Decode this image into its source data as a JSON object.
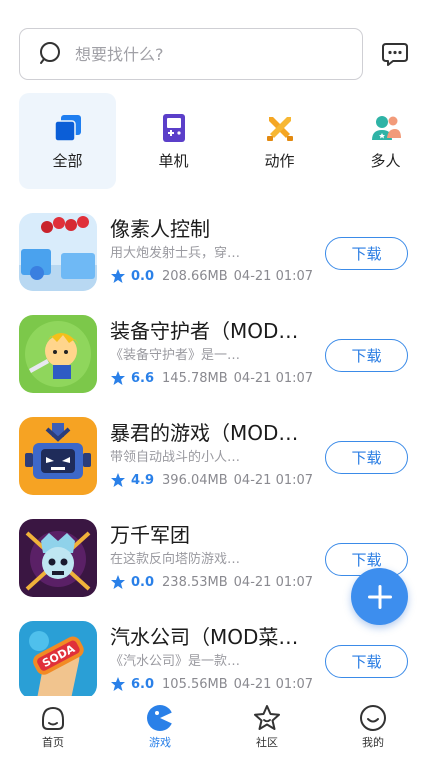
{
  "search": {
    "placeholder": "想要找什么?"
  },
  "categories": [
    {
      "label": "全部",
      "icon": "stack-icon",
      "active": true
    },
    {
      "label": "单机",
      "icon": "gameboy-icon"
    },
    {
      "label": "动作",
      "icon": "crossed-swords-icon"
    },
    {
      "label": "多人",
      "icon": "people-icon"
    }
  ],
  "apps": [
    {
      "name": "像素人控制",
      "desc": "用大炮发射士兵，穿…",
      "score": "0.0",
      "size": "208.66MB",
      "date": "04-21 01:07",
      "download": "下载"
    },
    {
      "name": "装备守护者（MOD…",
      "desc": "《装备守护者》是一…",
      "score": "6.6",
      "size": "145.78MB",
      "date": "04-21 01:07",
      "download": "下载"
    },
    {
      "name": "暴君的游戏（MOD…",
      "desc": "带领自动战斗的小人…",
      "score": "4.9",
      "size": "396.04MB",
      "date": "04-21 01:07",
      "download": "下载"
    },
    {
      "name": "万千军团",
      "desc": "在这款反向塔防游戏…",
      "score": "0.0",
      "size": "238.53MB",
      "date": "04-21 01:07",
      "download": "下载"
    },
    {
      "name": "汽水公司（MOD菜…",
      "desc": "《汽水公司》是一款…",
      "score": "6.0",
      "size": "105.56MB",
      "date": "04-21 01:07",
      "download": "下载"
    }
  ],
  "nav": [
    {
      "label": "首页",
      "icon": "home-icon"
    },
    {
      "label": "游戏",
      "icon": "game-icon",
      "active": true
    },
    {
      "label": "社区",
      "icon": "star-icon"
    },
    {
      "label": "我的",
      "icon": "smile-icon"
    }
  ],
  "colors": {
    "accent": "#3d8eee",
    "text": "#1b1b1b",
    "muted": "#9a9aa0"
  }
}
